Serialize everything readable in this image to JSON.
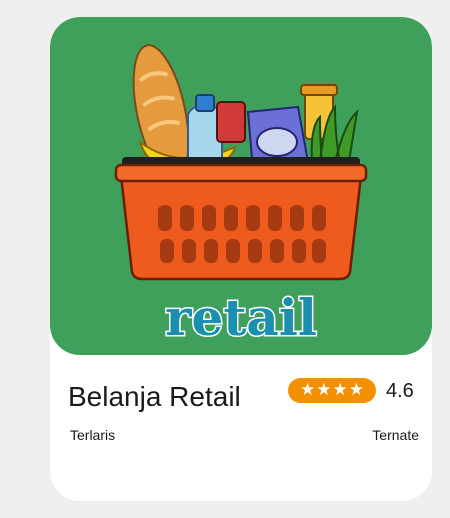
{
  "card": {
    "name": "Belanja Retail",
    "rating": "4.6",
    "stars": 4,
    "tag": "Terlaris",
    "location": "Ternate",
    "logo_text": "retail"
  },
  "colors": {
    "page_bg": "#efefef",
    "hero_bg": "#3fa05c",
    "rating_pill": "#f29000",
    "basket": "#ef5a1e"
  },
  "icons": {
    "hero": "grocery-basket-icon",
    "star": "star-icon"
  }
}
